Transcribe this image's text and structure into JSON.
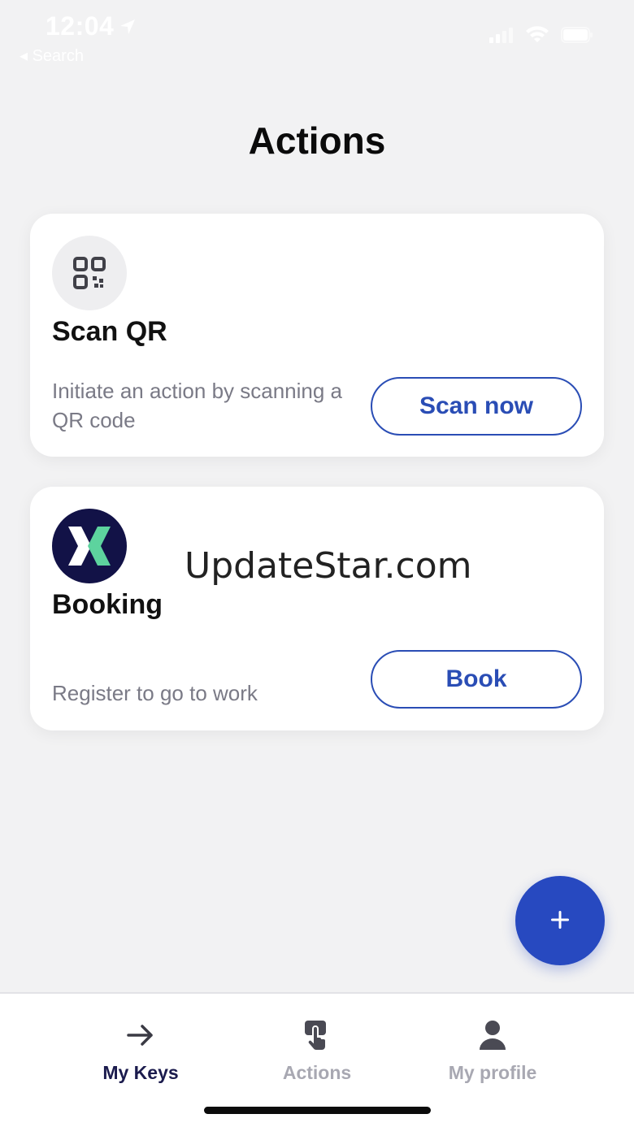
{
  "status_bar": {
    "time": "12:04",
    "back_label": "◂ Search",
    "icons": [
      "location-arrow-icon",
      "cellular-signal-icon",
      "wifi-icon",
      "battery-icon"
    ]
  },
  "page": {
    "title": "Actions"
  },
  "cards": [
    {
      "icon": "qr-code-icon",
      "title": "Scan QR",
      "description": "Initiate an action by scanning a QR code",
      "button_label": "Scan now"
    },
    {
      "icon": "booking-logo-icon",
      "title": "Booking",
      "description": "Register to go to work",
      "button_label": "Book",
      "watermark": "UpdateStar.com"
    }
  ],
  "fab": {
    "icon": "plus-icon",
    "label": "+"
  },
  "tab_bar": {
    "items": [
      {
        "label": "My Keys",
        "icon": "arrow-right-icon",
        "active": true
      },
      {
        "label": "Actions",
        "icon": "tap-hand-icon",
        "active": false
      },
      {
        "label": "My profile",
        "icon": "person-icon",
        "active": false
      }
    ]
  },
  "colors": {
    "accent": "#2749c0",
    "background": "#f2f2f3",
    "logo_bg": "#121247",
    "logo_green": "#5dd39e",
    "muted_text": "#7a7a86",
    "tab_inactive": "#a8a8b2",
    "tab_active": "#1b1b4d"
  }
}
